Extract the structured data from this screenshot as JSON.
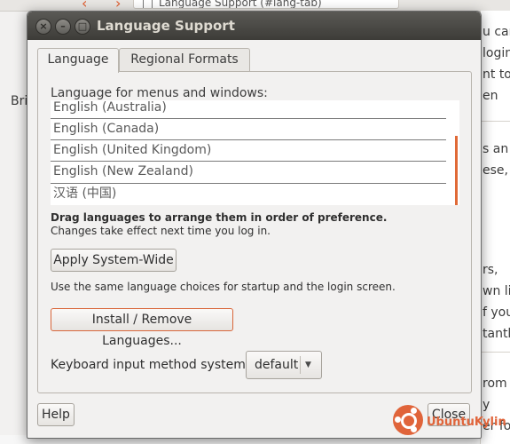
{
  "browser": {
    "tab_title": "Language Support (#lang-tab)",
    "left_fragment": "Bri",
    "right_fragments": [
      "u car",
      "login",
      "nt to",
      "en",
      "s an",
      "ese,",
      "rs,",
      "wn lis",
      "f you",
      "tantly",
      "rom",
      "y",
      "er fo"
    ]
  },
  "window": {
    "title": "Language Support",
    "close_glyph": "×",
    "min_glyph": "–",
    "max_glyph": "□"
  },
  "tabs": [
    {
      "label": "Language"
    },
    {
      "label": "Regional Formats"
    }
  ],
  "language": {
    "menus_label": "Language for menus and windows:",
    "languages": [
      "English (Australia)",
      "English (Canada)",
      "English (United Kingdom)",
      "English (New Zealand)",
      "汉语 (中国)"
    ],
    "drag_hint": "Drag languages to arrange them in order of preference.",
    "changes_note": "Changes take effect next time you log in.",
    "apply_button": "Apply System-Wide",
    "apply_desc": "Use the same language choices for startup and the login screen.",
    "install_button": "Install / Remove Languages...",
    "keyboard_label": "Keyboard input method system:",
    "keyboard_value": "default",
    "dropdown_arrow": "▼"
  },
  "footer": {
    "help_button": "Help",
    "close_button": "Close"
  },
  "watermark": {
    "text": "UbuntuKylin"
  },
  "colors": {
    "accent": "#e0643a",
    "titlebar": "#3d3c38",
    "background": "#f2f1f0"
  }
}
